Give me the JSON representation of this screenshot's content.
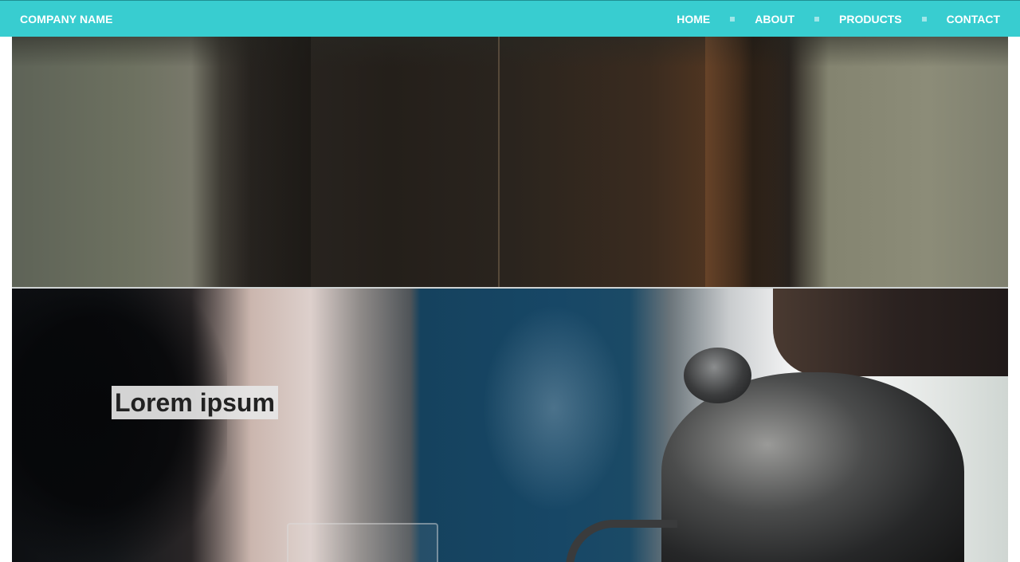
{
  "navbar": {
    "brand": "COMPANY NAME",
    "links": [
      "HOME",
      "ABOUT",
      "PRODUCTS",
      "CONTACT"
    ],
    "background_color": "#38cdd0"
  },
  "hero_top": {
    "image_subject": "leather jacket"
  },
  "hero_bottom": {
    "heading": "Lorem ipsum",
    "image_subject": "pour-over coffee kettle"
  }
}
